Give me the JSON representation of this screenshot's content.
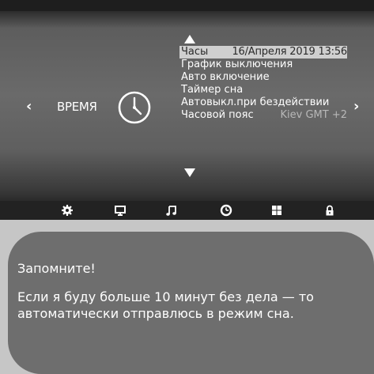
{
  "section": {
    "title": "ВРЕМЯ"
  },
  "nav": {
    "left_arrow": "‹",
    "right_arrow": "›"
  },
  "menu": {
    "items": [
      {
        "label": "Часы",
        "value": "16/Апреля  2019  13:56"
      },
      {
        "label": "График выключения"
      },
      {
        "label": "Авто включение"
      },
      {
        "label": "Таймер сна"
      },
      {
        "label": "Автовыкл.при бездействии"
      },
      {
        "label": "Часовой пояс",
        "value": "Kiev GMT +2"
      }
    ]
  },
  "iconbar": [
    "gear-icon",
    "monitor-icon",
    "music-note-icon",
    "clock-icon",
    "grid-icon",
    "lock-icon"
  ],
  "note": {
    "title": "Запомните!",
    "text": "Если я буду больше 10 минут без дела — то автоматически отправлюсь в режим сна."
  },
  "colors": {
    "bubble": "#6e6e6e",
    "selection": "#cfcfcf",
    "background": "#c6c6c6"
  }
}
